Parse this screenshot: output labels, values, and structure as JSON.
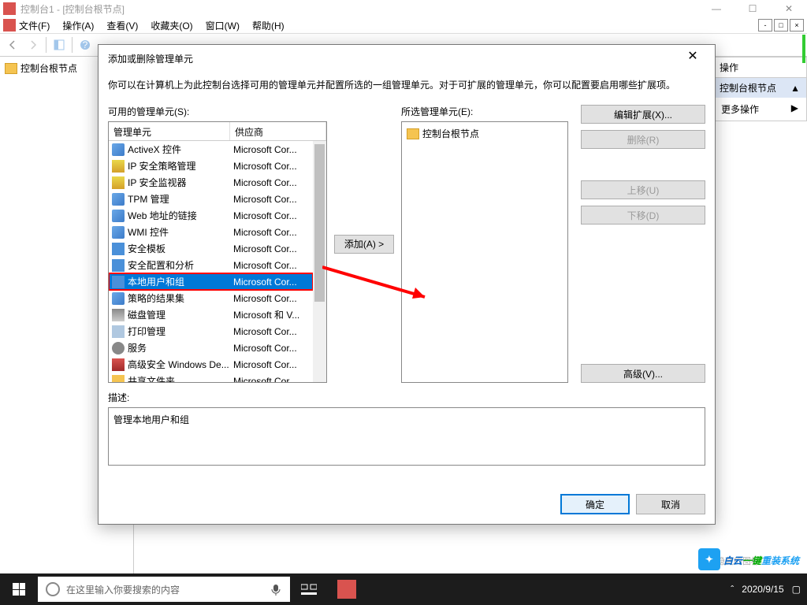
{
  "window": {
    "title": "控制台1 - [控制台根节点]",
    "menus": [
      "文件(F)",
      "操作(A)",
      "查看(V)",
      "收藏夹(O)",
      "窗口(W)",
      "帮助(H)"
    ],
    "tree_root": "控制台根节点"
  },
  "actions_pane": {
    "title": "控制台根节点",
    "more": "更多操作"
  },
  "dialog": {
    "title": "添加或删除管理单元",
    "desc": "你可以在计算机上为此控制台选择可用的管理单元并配置所选的一组管理单元。对于可扩展的管理单元，你可以配置要启用哪些扩展项。",
    "available_label": "可用的管理单元(S):",
    "selected_label": "所选管理单元(E):",
    "col_snap": "管理单元",
    "col_vendor": "供应商",
    "add_btn": "添加(A) >",
    "btn_ext": "编辑扩展(X)...",
    "btn_del": "删除(R)",
    "btn_up": "上移(U)",
    "btn_down": "下移(D)",
    "btn_adv": "高级(V)...",
    "desc_label": "描述:",
    "desc_text": "管理本地用户和组",
    "ok": "确定",
    "cancel": "取消",
    "selected_root": "控制台根节点",
    "snapins": [
      {
        "name": "ActiveX 控件",
        "vendor": "Microsoft Cor...",
        "ico": "ico-generic"
      },
      {
        "name": "IP 安全策略管理",
        "vendor": "Microsoft Cor...",
        "ico": "ico-shield"
      },
      {
        "name": "IP 安全监视器",
        "vendor": "Microsoft Cor...",
        "ico": "ico-shield"
      },
      {
        "name": "TPM 管理",
        "vendor": "Microsoft Cor...",
        "ico": "ico-generic"
      },
      {
        "name": "Web 地址的链接",
        "vendor": "Microsoft Cor...",
        "ico": "ico-generic"
      },
      {
        "name": "WMI 控件",
        "vendor": "Microsoft Cor...",
        "ico": "ico-generic"
      },
      {
        "name": "安全模板",
        "vendor": "Microsoft Cor...",
        "ico": "ico-blue"
      },
      {
        "name": "安全配置和分析",
        "vendor": "Microsoft Cor...",
        "ico": "ico-blue"
      },
      {
        "name": "本地用户和组",
        "vendor": "Microsoft Cor...",
        "ico": "ico-blue",
        "selected": true
      },
      {
        "name": "策略的结果集",
        "vendor": "Microsoft Cor...",
        "ico": "ico-generic"
      },
      {
        "name": "磁盘管理",
        "vendor": "Microsoft 和 V...",
        "ico": "ico-disk"
      },
      {
        "name": "打印管理",
        "vendor": "Microsoft Cor...",
        "ico": "ico-printer"
      },
      {
        "name": "服务",
        "vendor": "Microsoft Cor...",
        "ico": "ico-gear"
      },
      {
        "name": "高级安全 Windows De...",
        "vendor": "Microsoft Cor...",
        "ico": "ico-firewall"
      },
      {
        "name": "共享文件夹",
        "vendor": "Microsoft Cor...",
        "ico": "ico-folder"
      }
    ]
  },
  "taskbar": {
    "search_placeholder": "在这里输入你要搜索的内容",
    "time": "2020/9/15"
  },
  "watermark": {
    "text": "白云一键重装系统",
    "activate": "显示隐藏的图标"
  }
}
